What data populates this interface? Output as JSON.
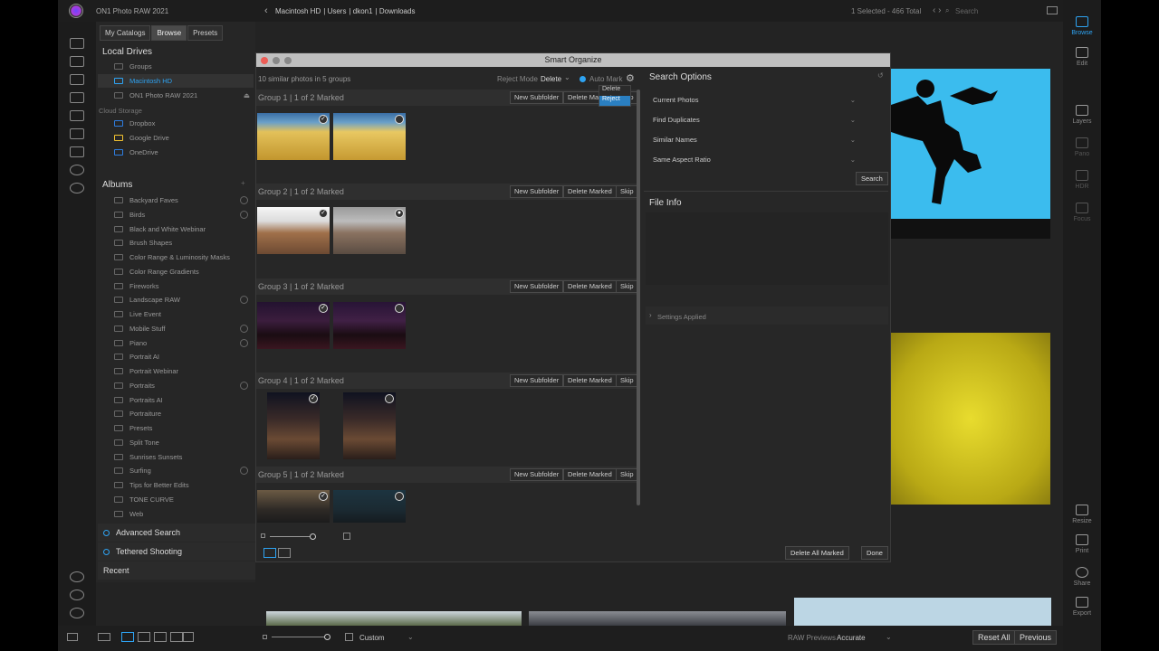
{
  "app": {
    "title": "ON1 Photo RAW 2021"
  },
  "breadcrumb": [
    "Macintosh HD",
    "Users",
    "dkon1",
    "Downloads"
  ],
  "top": {
    "selected": "1 Selected - 466 Total",
    "search_placeholder": "Search"
  },
  "browser_tabs": [
    "My Catalogs",
    "Browse",
    "Presets"
  ],
  "local_drives": {
    "title": "Local Drives",
    "items": [
      "Groups",
      "Macintosh HD",
      "ON1 Photo RAW 2021"
    ]
  },
  "cloud": {
    "title": "Cloud Storage",
    "items": [
      "Dropbox",
      "Google Drive",
      "OneDrive"
    ]
  },
  "albums": {
    "title": "Albums",
    "items": [
      "Backyard Faves",
      "Birds",
      "Black and White Webinar",
      "Brush Shapes",
      "Color Range & Luminosity Masks",
      "Color Range Gradients",
      "Fireworks",
      "Landscape RAW",
      "Live Event",
      "Mobile Stuff",
      "Piano",
      "Portrait AI",
      "Portrait Webinar",
      "Portraits",
      "Portraits AI",
      "Portraiture",
      "Presets",
      "Split Tone",
      "Sunrises Sunsets",
      "Surfing",
      "Tips for Better Edits",
      "TONE CURVE",
      "Web"
    ]
  },
  "sections": [
    "Advanced Search",
    "Tethered Shooting",
    "Recent"
  ],
  "right_tools": [
    "Browse",
    "Edit",
    "Layers",
    "Pano",
    "HDR",
    "Focus",
    "Resize",
    "Print",
    "Share",
    "Export"
  ],
  "dialog": {
    "title": "Smart Organize",
    "summary": "10 similar photos in 5 groups",
    "reject_mode_label": "Reject Mode",
    "reject_mode_value": "Delete",
    "auto_mark": "Auto Mark",
    "dropdown": [
      "Delete",
      "Reject"
    ],
    "groups": [
      {
        "name": "Group 1 | 1 of 2 Marked"
      },
      {
        "name": "Group 2 | 1 of 2 Marked"
      },
      {
        "name": "Group 3 | 1 of 2 Marked"
      },
      {
        "name": "Group 4 | 1 of 2 Marked"
      },
      {
        "name": "Group 5 | 1 of 2 Marked"
      }
    ],
    "group_buttons": {
      "new_subfolder": "New Subfolder",
      "delete_marked": "Delete Marked",
      "skip": "Skip"
    },
    "search_options_title": "Search Options",
    "search_options": [
      "Current Photos",
      "Find Duplicates",
      "Similar Names",
      "Same Aspect Ratio"
    ],
    "search_button": "Search",
    "file_info_title": "File Info",
    "settings_applied": "Settings Applied",
    "delete_all_marked": "Delete All Marked",
    "done": "Done"
  },
  "bottom": {
    "view": "Custom",
    "raw_previews_label": "RAW Previews",
    "raw_previews_value": "Accurate",
    "reset_all": "Reset All",
    "previous": "Previous"
  },
  "colors": {
    "accent": "#2ea3f2",
    "bg": "#232323"
  }
}
